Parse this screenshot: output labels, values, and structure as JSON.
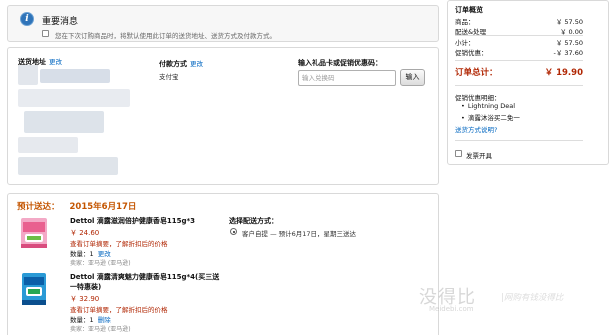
{
  "alert": {
    "title": "重要消息",
    "checkbox_text": "您在下次订购商品时，将默认使用此订单的送货地址、送货方式及付款方式。"
  },
  "address": {
    "label": "送货地址",
    "change": "更改"
  },
  "payment": {
    "label": "付款方式",
    "change": "更改",
    "value": "支付宝"
  },
  "coupon": {
    "label": "输入礼品卡或促销优惠码：",
    "placeholder": "输入兑换码",
    "button": "输入"
  },
  "shipment": {
    "estimate_label": "预计送达：",
    "estimate_date": "2015年6月17日",
    "choose_label": "选择配送方式：",
    "option_text": "客户自提 — 预计6月17日，星期三送达",
    "items": [
      {
        "name": "Dettol 滴露滋润倍护健康香皂115g*3",
        "price": "￥ 24.60",
        "warning": "查看订单摘要，了解折扣后的价格",
        "qty_label": "数量：",
        "qty": "1",
        "qty_action": "更改",
        "seller": "卖家：亚马逊 (亚马逊)"
      },
      {
        "name_line1": "Dettol 滴露清爽魅力健康香皂115g*4(买三送",
        "name_line2": "一特惠装)",
        "price": "￥ 32.90",
        "warning": "查看订单摘要，了解折扣后的价格",
        "qty_label": "数量：",
        "qty": "1",
        "qty_action": "删除",
        "seller": "卖家：亚马逊 (亚马逊)"
      }
    ]
  },
  "summary": {
    "title": "订单概览",
    "rows": [
      {
        "label": "商品：",
        "value": "￥ 57.50"
      },
      {
        "label": "配送&处理",
        "value": "￥ 0.00"
      },
      {
        "label": "小计：",
        "value": "￥ 57.50"
      },
      {
        "label": "促销优惠：",
        "value": "-￥ 37.60"
      }
    ],
    "total_label": "订单总计：",
    "total_value": "￥ 19.90",
    "promo_heading": "促销优惠明细：",
    "promos": [
      "Lightning Deal",
      "滴露沐浴买二免一"
    ],
    "promo_link": "送货方式说明?",
    "invoice_label": "发票开具"
  },
  "watermark": {
    "brand": "没得比",
    "slogan": "|网购有钱没得比",
    "url": "Meidebi.com"
  },
  "colors": {
    "accent": "#c45500",
    "price": "#b12704",
    "link": "#0066c0",
    "info": "#2f74b9"
  }
}
